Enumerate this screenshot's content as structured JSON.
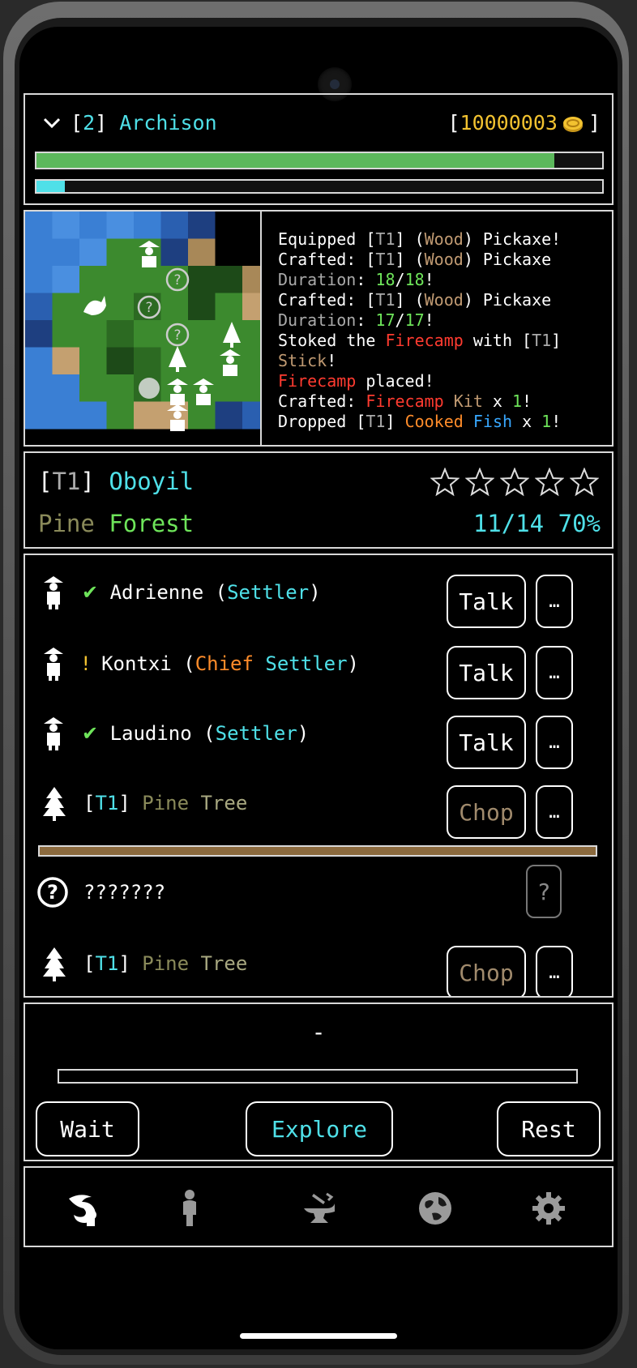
{
  "header": {
    "level": "2",
    "player_name": "Archison",
    "gold": "10000003",
    "health_fraction": 0.915,
    "energy_fraction": 0.05
  },
  "log": [
    [
      {
        "t": "Equipped [",
        "c": "#fff"
      },
      {
        "t": "T1",
        "c": "#aaa"
      },
      {
        "t": "] (",
        "c": "#fff"
      },
      {
        "t": "Wood",
        "c": "#c09a72"
      },
      {
        "t": ") Pickaxe!",
        "c": "#fff"
      }
    ],
    [
      {
        "t": "Crafted: [",
        "c": "#fff"
      },
      {
        "t": "T1",
        "c": "#aaa"
      },
      {
        "t": "] (",
        "c": "#fff"
      },
      {
        "t": "Wood",
        "c": "#c09a72"
      },
      {
        "t": ") Pickaxe",
        "c": "#fff"
      }
    ],
    [
      {
        "t": "Duration",
        "c": "#aaa"
      },
      {
        "t": ": ",
        "c": "#fff"
      },
      {
        "t": "18",
        "c": "#6ee45a"
      },
      {
        "t": "/",
        "c": "#fff"
      },
      {
        "t": "18",
        "c": "#6ee45a"
      },
      {
        "t": "!",
        "c": "#fff"
      }
    ],
    [
      {
        "t": "Crafted: [",
        "c": "#fff"
      },
      {
        "t": "T1",
        "c": "#aaa"
      },
      {
        "t": "] (",
        "c": "#fff"
      },
      {
        "t": "Wood",
        "c": "#c09a72"
      },
      {
        "t": ") Pickaxe",
        "c": "#fff"
      }
    ],
    [
      {
        "t": "Duration",
        "c": "#aaa"
      },
      {
        "t": ": ",
        "c": "#fff"
      },
      {
        "t": "17",
        "c": "#6ee45a"
      },
      {
        "t": "/",
        "c": "#fff"
      },
      {
        "t": "17",
        "c": "#6ee45a"
      },
      {
        "t": "!",
        "c": "#fff"
      }
    ],
    [
      {
        "t": "Stoked the ",
        "c": "#fff"
      },
      {
        "t": "Firecamp",
        "c": "#ff3b30"
      },
      {
        "t": " with [",
        "c": "#fff"
      },
      {
        "t": "T1",
        "c": "#aaa"
      },
      {
        "t": "]",
        "c": "#fff"
      }
    ],
    [
      {
        "t": "Stick",
        "c": "#c09a72"
      },
      {
        "t": "!",
        "c": "#fff"
      }
    ],
    [
      {
        "t": "Firecamp",
        "c": "#ff3b30"
      },
      {
        "t": " placed!",
        "c": "#fff"
      }
    ],
    [
      {
        "t": "Crafted: ",
        "c": "#fff"
      },
      {
        "t": "Firecamp",
        "c": "#ff3b30"
      },
      {
        "t": " ",
        "c": "#fff"
      },
      {
        "t": "Kit",
        "c": "#c09a72"
      },
      {
        "t": " x ",
        "c": "#fff"
      },
      {
        "t": "1",
        "c": "#6ee45a"
      },
      {
        "t": "!",
        "c": "#fff"
      }
    ],
    [
      {
        "t": "Dropped [",
        "c": "#fff"
      },
      {
        "t": "T1",
        "c": "#aaa"
      },
      {
        "t": "] ",
        "c": "#fff"
      },
      {
        "t": "Cooked",
        "c": "#ff8c2a"
      },
      {
        "t": " ",
        "c": "#fff"
      },
      {
        "t": "Fish",
        "c": "#38a8ff"
      },
      {
        "t": " x ",
        "c": "#fff"
      },
      {
        "t": "1",
        "c": "#6ee45a"
      },
      {
        "t": "!",
        "c": "#fff"
      }
    ]
  ],
  "location": {
    "tier": "T1",
    "name": "Oboyil",
    "biome_word1": "Pine",
    "biome_word2": "Forest",
    "progress": "11/14",
    "percent": "70%",
    "stars_filled": 0
  },
  "entities": [
    {
      "icon": "settler-icon",
      "status": "✔",
      "name": "Adrienne",
      "role1": "Settler",
      "role2": "",
      "action": "Talk",
      "more": "…"
    },
    {
      "icon": "chief-settler-icon",
      "status": "!",
      "name": "Kontxi",
      "role1": "Chief",
      "role2": "Settler",
      "action": "Talk",
      "more": "…"
    },
    {
      "icon": "settler-icon",
      "status": "✔",
      "name": "Laudino",
      "role1": "Settler",
      "role2": "",
      "action": "Talk",
      "more": "…"
    },
    {
      "icon": "pine-tree-icon",
      "tier": "T1",
      "name1": "Pine",
      "name2": "Tree",
      "action": "Chop",
      "more": "…",
      "health_fraction": 1.0
    },
    {
      "icon": "unknown-icon",
      "name": "???????",
      "action": "?"
    },
    {
      "icon": "pine-tree-icon",
      "tier": "T1",
      "name1": "Pine",
      "name2": "Tree",
      "action": "Chop",
      "more": "…",
      "health_fraction": 1.0
    }
  ],
  "action_panel": {
    "status": "-",
    "wait": "Wait",
    "explore": "Explore",
    "rest": "Rest"
  },
  "nav": [
    "explore-nav-icon",
    "character-nav-icon",
    "crafting-nav-icon",
    "world-nav-icon",
    "settings-nav-icon"
  ],
  "colors": {
    "cyan": "#4fe0e8",
    "gold": "#f2c230",
    "health": "#5cb85c",
    "energy": "#4fe0e8",
    "olive": "#8a8a5a",
    "tree_bar": "#8b6a3e"
  }
}
